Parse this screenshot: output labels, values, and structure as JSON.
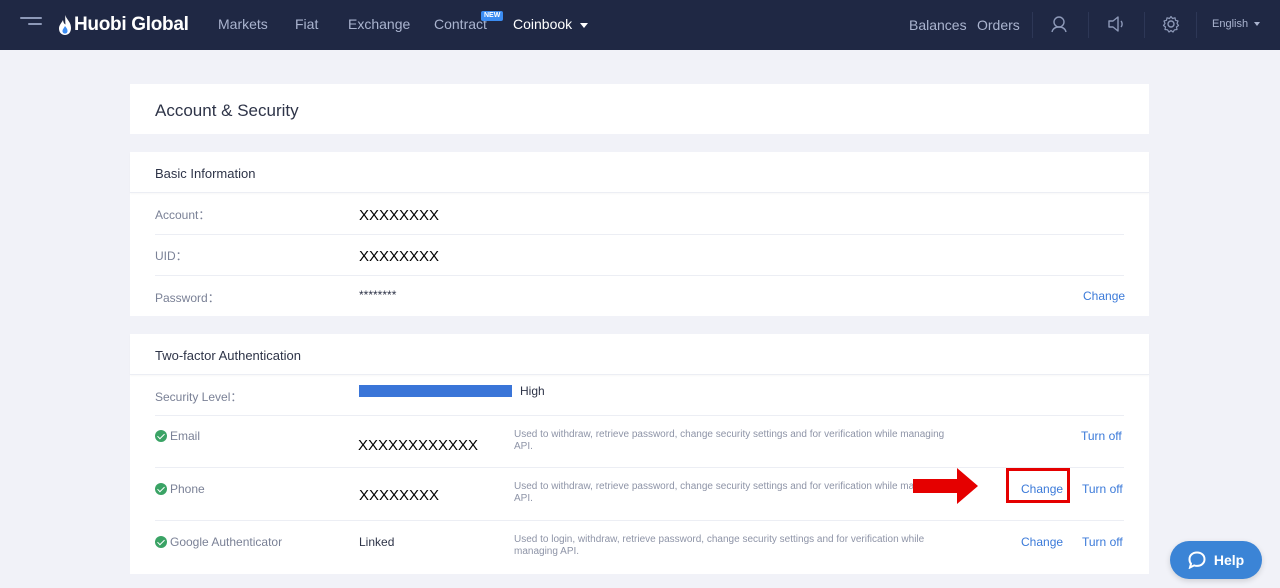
{
  "nav": {
    "brand": "Huobi Global",
    "links": [
      "Markets",
      "Fiat",
      "Exchange",
      "Contract"
    ],
    "new_badge": "NEW",
    "coinbook": "Coinbook",
    "balances": "Balances",
    "orders": "Orders",
    "language": "English"
  },
  "page": {
    "title": "Account & Security"
  },
  "basic": {
    "title": "Basic Information",
    "rows": [
      {
        "label": "Account：",
        "value": "XXXXXXXX"
      },
      {
        "label": "UID：",
        "value": "XXXXXXXX"
      },
      {
        "label": "Password：",
        "value": "********",
        "action": "Change"
      }
    ]
  },
  "tfa": {
    "title": "Two-factor Authentication",
    "security_label": "Security Level：",
    "security_value": "High",
    "security_level": 1.0,
    "rows": [
      {
        "label": "Email",
        "value": "XXXXXXXXXXXX",
        "desc": "Used to withdraw, retrieve password, change security settings and for verification while managing API.",
        "turn_off": "Turn off"
      },
      {
        "label": "Phone",
        "value": "XXXXXXXX",
        "desc": "Used to withdraw, retrieve password, change security settings and for verification while managing API.",
        "change": "Change",
        "turn_off": "Turn off"
      },
      {
        "label": "Google Authenticator",
        "value": "Linked",
        "desc": "Used to login, withdraw, retrieve password, change security settings and for verification while managing API.",
        "change": "Change",
        "turn_off": "Turn off"
      }
    ]
  },
  "help": {
    "label": "Help"
  },
  "colors": {
    "nav_bg": "#1f2844",
    "accent": "#3b7ad9",
    "security_bar": "#3a75d8",
    "highlight": "#e50000",
    "check": "#3aa365"
  }
}
